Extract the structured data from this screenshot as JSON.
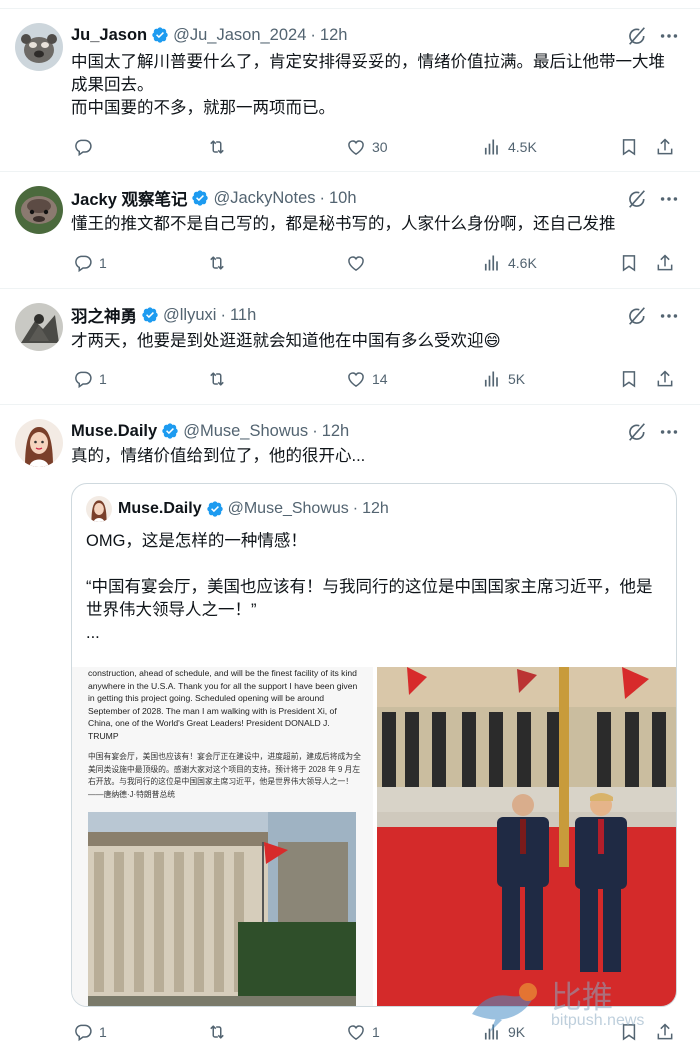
{
  "colors": {
    "verified": "#1d9bf0",
    "secondary": "#536471",
    "text": "#0f1419",
    "border": "#cfd9de"
  },
  "tweets": [
    {
      "name": "Ju_Jason",
      "handle": "@Ju_Jason_2024",
      "time": "12h",
      "text": "中国太了解川普要什么了，肯定安排得妥妥的，情绪价值拉满。最后让他带一大堆成果回去。\n而中国要的不多，就那一两项而已。",
      "reply_count": "",
      "retweet_count": "",
      "like_count": "30",
      "view_count": "4.5K"
    },
    {
      "name": "Jacky 观察笔记",
      "handle": "@JackyNotes",
      "time": "10h",
      "text": "懂王的推文都不是自己写的，都是秘书写的，人家什么身份啊，还自己发推",
      "reply_count": "1",
      "retweet_count": "",
      "like_count": "",
      "view_count": "4.6K"
    },
    {
      "name": "羽之神勇",
      "handle": "@llyuxi",
      "time": "11h",
      "text": "才两天，他要是到处逛逛就会知道他在中国有多么受欢迎😄",
      "reply_count": "1",
      "retweet_count": "",
      "like_count": "14",
      "view_count": "5K"
    },
    {
      "name": "Muse.Daily",
      "handle": "@Muse_Showus",
      "time": "12h",
      "text": "真的，情绪价值给到位了，他的很开心...",
      "reply_count": "1",
      "retweet_count": "",
      "like_count": "1",
      "view_count": "9K"
    }
  ],
  "quote": {
    "name": "Muse.Daily",
    "handle": "@Muse_Showus",
    "time": "12h",
    "text": "OMG，这是怎样的一种情感！\n\n“中国有宴会厅，美国也应该有！与我同行的这位是中国国家主席习近平，他是世界伟大领导人之一！”\n...",
    "post_en": "construction, ahead of schedule, and will be the finest facility of its kind anywhere in the U.S.A. Thank you for all the support I have been given in getting this project going. Scheduled opening will be around September of 2028. The man I am walking with is President Xi, of China, one of the World's Great Leaders! President DONALD J. TRUMP",
    "post_cn": "中国有宴会厅，美国也应该有！宴会厅正在建设中，进度超前，建成后将成为全美同类设施中最顶级的。感谢大家对这个项目的支持。预计将于 2028 年 9 月左右开放。与我同行的这位是中国国家主席习近平，他是世界伟大领导人之一！——唐纳德·J·特朗普总统"
  },
  "watermark": {
    "cn": "比推",
    "en": "bitpush.news"
  },
  "icons": [
    "verified-badge-icon",
    "grok-icon",
    "more-icon",
    "reply-icon",
    "retweet-icon",
    "like-icon",
    "views-icon",
    "bookmark-icon",
    "share-icon"
  ]
}
